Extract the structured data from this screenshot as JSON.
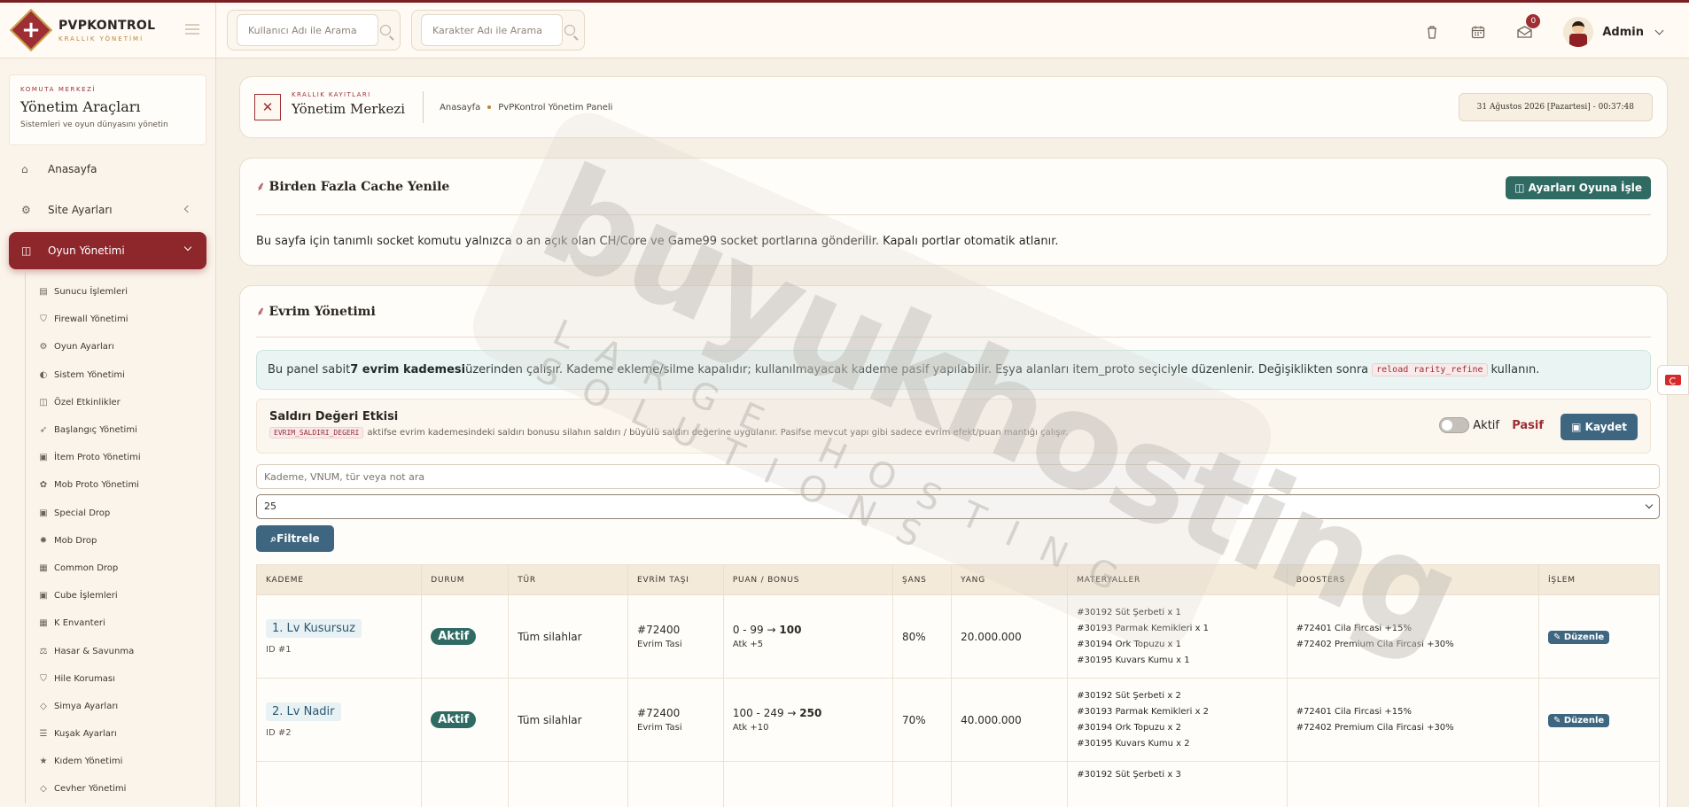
{
  "brand": {
    "title": "PVPKONTROL",
    "subtitle": "KRALLIK YÖNETİMİ"
  },
  "search": {
    "user_placeholder": "Kullanıcı Adı ile Arama",
    "char_placeholder": "Karakter Adı ile Arama"
  },
  "topbar": {
    "notification_count": "0",
    "admin_name": "Admin"
  },
  "sidebar": {
    "card_kicker": "KOMUTA MERKEZİ",
    "card_title": "Yönetim Araçları",
    "card_desc": "Sistemleri ve oyun dünyasını yönetin",
    "items": [
      {
        "label": "Anasayfa",
        "icon": "home-icon"
      },
      {
        "label": "Site Ayarları",
        "icon": "gear-icon"
      },
      {
        "label": "Oyun Yönetimi",
        "icon": "gamepad-icon"
      }
    ],
    "sub_items": [
      {
        "label": "Sunucu İşlemleri",
        "icon": "server-icon",
        "glyph": "▤"
      },
      {
        "label": "Firewall Yönetimi",
        "icon": "shield-icon",
        "glyph": "⛉"
      },
      {
        "label": "Oyun Ayarları",
        "icon": "cogs-icon",
        "glyph": "⚙"
      },
      {
        "label": "Sistem Yönetimi",
        "icon": "toggle-icon",
        "glyph": "◐"
      },
      {
        "label": "Özel Etkinlikler",
        "icon": "gamepad-icon",
        "glyph": "◫"
      },
      {
        "label": "Başlangıç Yönetimi",
        "icon": "rocket-icon",
        "glyph": "➶"
      },
      {
        "label": "İtem Proto Yönetimi",
        "icon": "box-icon",
        "glyph": "▣"
      },
      {
        "label": "Mob Proto Yönetimi",
        "icon": "paw-icon",
        "glyph": "✿"
      },
      {
        "label": "Special Drop",
        "icon": "box-icon",
        "glyph": "▣"
      },
      {
        "label": "Mob Drop",
        "icon": "bug-icon",
        "glyph": "✹"
      },
      {
        "label": "Common Drop",
        "icon": "table-icon",
        "glyph": "▦"
      },
      {
        "label": "Cube İşlemleri",
        "icon": "cube-icon",
        "glyph": "▣"
      },
      {
        "label": "K Envanteri",
        "icon": "grid-icon",
        "glyph": "▦"
      },
      {
        "label": "Hasar & Savunma",
        "icon": "balance-icon",
        "glyph": "⚖"
      },
      {
        "label": "Hile Koruması",
        "icon": "shield-icon",
        "glyph": "⛉"
      },
      {
        "label": "Simya Ayarları",
        "icon": "gem-icon",
        "glyph": "◇"
      },
      {
        "label": "Kuşak Ayarları",
        "icon": "sliders-icon",
        "glyph": "☰"
      },
      {
        "label": "Kıdem Yönetimi",
        "icon": "star-icon",
        "glyph": "★"
      },
      {
        "label": "Cevher Yönetimi",
        "icon": "gem-icon",
        "glyph": "◇"
      }
    ]
  },
  "breadcrumb": {
    "kicker": "KRALLIK KAYITLARI",
    "title": "Yönetim Merkezi",
    "home": "Anasayfa",
    "current": "PvPKontrol Yönetim Paneli",
    "datetime": "31 Ağustos 2026 [Pazartesi] - 00:37:48"
  },
  "cache_card": {
    "title": "Birden Fazla Cache Yenile",
    "button": "Ayarları Oyuna İşle",
    "text": "Bu sayfa için tanımlı socket komutu yalnızca o an açık olan CH/Core ve Game99 socket portlarına gönderilir. Kapalı portlar otomatik atlanır."
  },
  "evrim": {
    "title": "Evrim Yönetimi",
    "info_prefix": "Bu panel sabit ",
    "info_bold": "7 evrim kademesi",
    "info_mid": " üzerinden çalışır. Kademe ekleme/silme kapalıdır; kullanılmayacak kademe pasif yapılabilir. Eşya alanları item_proto seçiciyle düzenlenir. Değişiklikten sonra",
    "info_code": "reload rarity_refine",
    "info_suffix": " kullanın.",
    "attack_title": "Saldırı Değeri Etkisi",
    "attack_code": "EVRIM_SALDIRI_DEGERI",
    "attack_desc": "aktifse evrim kademesindeki saldırı bonusu silahın saldırı / büyülü saldırı değerine uygulanır. Pasifse mevcut yapı gibi sadece evrim efekt/puan mantığı çalışır.",
    "toggle_on": "Aktif",
    "toggle_off": "Pasif",
    "save": "Kaydet",
    "filter_placeholder": "Kademe, VNUM, tür veya not ara",
    "page_size": "25",
    "filter_button": "Filtrele"
  },
  "table": {
    "headers": [
      "KADEME",
      "DURUM",
      "TÜR",
      "EVRİM TAŞI",
      "PUAN / BONUS",
      "ŞANS",
      "YANG",
      "MATERYALLER",
      "BOOSTERS",
      "İŞLEM"
    ],
    "rows": [
      {
        "tier": "1. Lv Kusursuz",
        "id": "ID #1",
        "status": "Aktif",
        "type": "Tüm silahlar",
        "stone": "#72400",
        "stone_name": "Evrim Tasi",
        "range": "0 - 99 →",
        "score": "100",
        "bonus": "Atk +5",
        "chance": "80%",
        "yang": "20.000.000",
        "materials": [
          "#30192 Süt Şerbeti x 1",
          "#30193 Parmak Kemikleri x 1",
          "#30194 Ork Topuzu x 1",
          "#30195 Kuvars Kumu x 1"
        ],
        "boosters": [
          "#72401 Cila Fircasi +15%",
          "#72402 Premium Cila Fircasi +30%"
        ],
        "action": "Düzenle"
      },
      {
        "tier": "2. Lv Nadir",
        "id": "ID #2",
        "status": "Aktif",
        "type": "Tüm silahlar",
        "stone": "#72400",
        "stone_name": "Evrim Tasi",
        "range": "100 - 249 →",
        "score": "250",
        "bonus": "Atk +10",
        "chance": "70%",
        "yang": "40.000.000",
        "materials": [
          "#30192 Süt Şerbeti x 2",
          "#30193 Parmak Kemikleri x 2",
          "#30194 Ork Topuzu x 2",
          "#30195 Kuvars Kumu x 2"
        ],
        "boosters": [
          "#72401 Cila Fircasi +15%",
          "#72402 Premium Cila Fircasi +30%"
        ],
        "action": "Düzenle"
      },
      {
        "materials_partial": [
          "#30192 Süt Şerbeti x 3"
        ]
      }
    ]
  },
  "watermark": {
    "main": "buyukhosting",
    "sub": "LARGE HOSTING SOLUTIONS"
  }
}
